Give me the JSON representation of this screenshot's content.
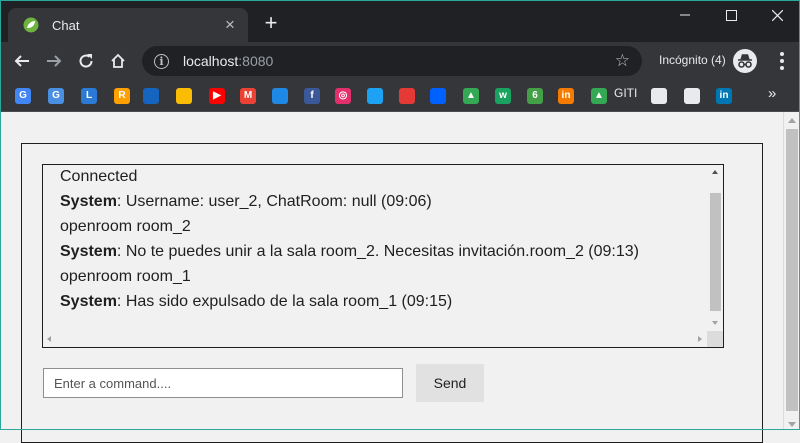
{
  "browser": {
    "tab": {
      "title": "Chat",
      "close_label": "×",
      "favicon": "spring-leaf-icon"
    },
    "new_tab_label": "+",
    "window_controls": [
      "minimize-icon",
      "maximize-icon",
      "close-icon"
    ],
    "address_bar": {
      "host": "localhost",
      "port": ":8080"
    },
    "incognito": {
      "label": "Incógnito (4)"
    },
    "bookmarks": [
      {
        "icon": "google-icon",
        "color": "#4285f4",
        "glyph": "G"
      },
      {
        "icon": "translate-icon",
        "color": "#4a90e2",
        "glyph": "G"
      },
      {
        "icon": "bookmark-icon",
        "color": "#2b7bd6",
        "glyph": "L"
      },
      {
        "icon": "bookmark-icon",
        "color": "#ffa000",
        "glyph": "R"
      },
      {
        "icon": "bookmark-icon",
        "color": "#1565c0",
        "glyph": ""
      },
      {
        "icon": "keep-icon",
        "color": "#fbbc04",
        "glyph": ""
      },
      {
        "icon": "youtube-icon",
        "color": "#ff0000",
        "glyph": "▶"
      },
      {
        "icon": "gmail-icon",
        "color": "#ea4335",
        "glyph": "M"
      },
      {
        "icon": "bookmark-icon",
        "color": "#1e88e5",
        "glyph": ""
      },
      {
        "icon": "facebook-icon",
        "color": "#3b5998",
        "glyph": "f"
      },
      {
        "icon": "instagram-icon",
        "color": "#e1306c",
        "glyph": "◎"
      },
      {
        "icon": "twitter-icon",
        "color": "#1da1f2",
        "glyph": ""
      },
      {
        "icon": "bookmark-icon",
        "color": "#e53935",
        "glyph": ""
      },
      {
        "icon": "dropbox-icon",
        "color": "#0061ff",
        "glyph": ""
      },
      {
        "icon": "drive-icon",
        "color": "#34a853",
        "glyph": "▲"
      },
      {
        "icon": "bookmark-icon",
        "color": "#1aa260",
        "glyph": "w"
      },
      {
        "icon": "bookmark-icon",
        "color": "#43a047",
        "glyph": "6"
      },
      {
        "icon": "bookmark-icon",
        "color": "#f57c00",
        "glyph": "in"
      },
      {
        "icon": "drive-icon",
        "color": "#34a853",
        "glyph": "▲"
      },
      {
        "icon": "github-icon",
        "color": "#e8eaed",
        "glyph": ""
      },
      {
        "icon": "bookmark-icon",
        "color": "#e8eaed",
        "glyph": ""
      },
      {
        "icon": "linkedin-icon",
        "color": "#0077b5",
        "glyph": "in"
      }
    ],
    "bookmark_text": "GITI",
    "bookmarks_more": "»"
  },
  "chat": {
    "messages": [
      {
        "sender": "",
        "text": "Connected"
      },
      {
        "sender": "System",
        "text": ": Username: user_2, ChatRoom: null (09:06)"
      },
      {
        "sender": "",
        "text": "openroom room_2"
      },
      {
        "sender": "System",
        "text": ": No te puedes unir a la sala room_2. Necesitas invitación.room_2 (09:13)"
      },
      {
        "sender": "",
        "text": "openroom room_1"
      },
      {
        "sender": "System",
        "text": ": Has sido expulsado de la sala room_1 (09:15)"
      }
    ],
    "command_input": {
      "value": "",
      "placeholder": "Enter a command...."
    },
    "send_label": "Send"
  }
}
